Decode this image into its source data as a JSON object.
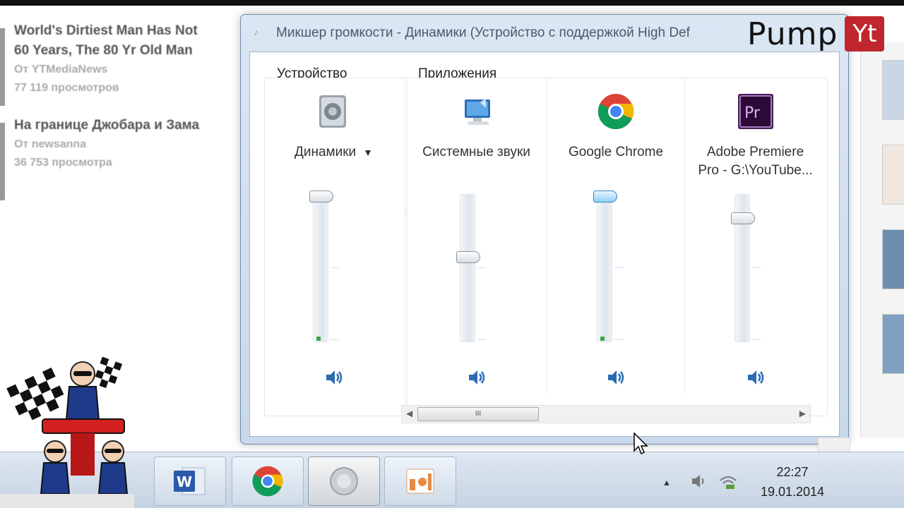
{
  "background_feed": [
    {
      "title": "World's Dirtiest Man Has Not\n60 Years, The 80 Yr Old Man",
      "channel": "От YTMediaNews",
      "views": "77 119 просмотров"
    },
    {
      "title": "На границе Джобара и Зама",
      "channel": "От newsanna",
      "views": "36 753 просмотра"
    }
  ],
  "window": {
    "title": "Микшер громкости - Динамики (Устройство с поддержкой High Def"
  },
  "mixer": {
    "device_group_label_underlined": "У",
    "device_group_label_rest": "стройство",
    "apps_group_label": "Приложения",
    "device": {
      "name": "Динамики",
      "icon": "speaker-device-icon",
      "level": 1.0
    },
    "apps": [
      {
        "name": "Системные звуки",
        "icon": "system-sounds-icon",
        "level": 0.56,
        "active": false
      },
      {
        "name": "Google Chrome",
        "icon": "chrome-icon",
        "level": 1.0,
        "active": true
      },
      {
        "name": "Adobe Premiere\nPro - G:\\YouTube...",
        "icon": "premiere-icon",
        "level": 0.84,
        "active": false
      }
    ],
    "scroll_grip": "III"
  },
  "watermark": {
    "pump": "Pump",
    "yt": "Yt"
  },
  "taskbar": {
    "time": "22:27",
    "date": "19.01.2014",
    "buttons": [
      "word-icon",
      "chrome-icon",
      "volume-mixer-icon",
      "presentation-icon"
    ]
  },
  "colors": {
    "accent": "#3a87bf",
    "level_indicator": "#3aa640",
    "watermark_red": "#c0262d"
  }
}
